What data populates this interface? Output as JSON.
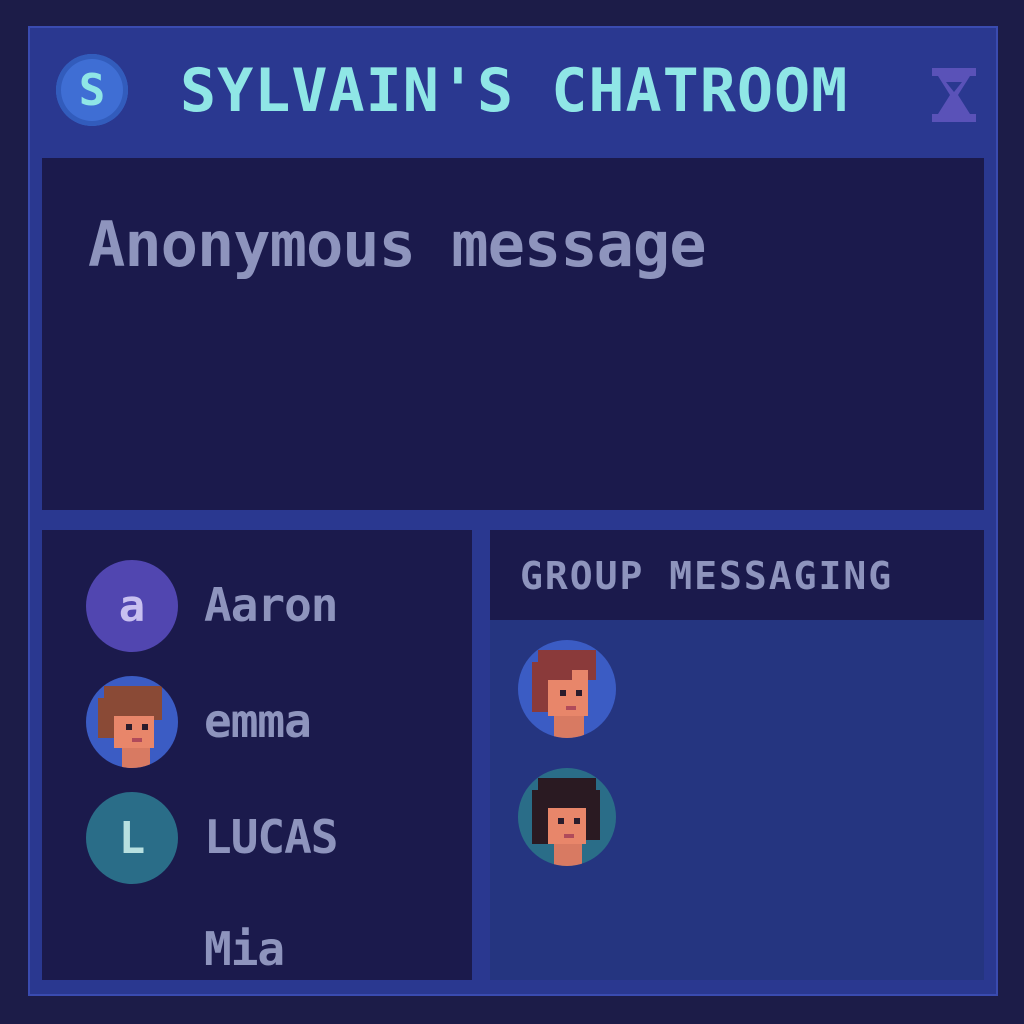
{
  "header": {
    "badge_letter": "S",
    "title": "SYLVAIN'S CHATROOM",
    "menu_icon": "hourglass-icon"
  },
  "message": {
    "text": "Anonymous message"
  },
  "users": [
    {
      "name": "Aaron",
      "avatar_letter": "a",
      "avatar_color": "#5146b0"
    },
    {
      "name": "emma",
      "avatar": "portrait-icon"
    },
    {
      "name": "LUCAS",
      "avatar_letter": "L",
      "avatar_color": "#2a6d88"
    },
    {
      "name": "Mia"
    }
  ],
  "group": {
    "title": "GROUP MESSAGING",
    "members": [
      "portrait-icon",
      "portrait-icon"
    ]
  },
  "colors": {
    "title": "#8fe6e6",
    "text": "#8e94bd",
    "frame": "#2a3890",
    "panel": "#1b1a4c"
  }
}
